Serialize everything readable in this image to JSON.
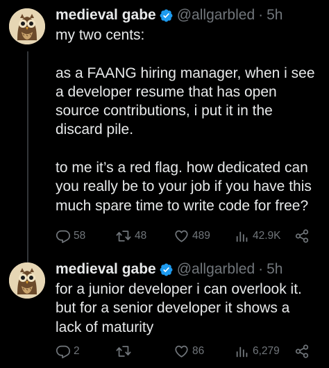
{
  "tweets": [
    {
      "author": {
        "display_name": "medieval gabe",
        "handle": "@allgarbled",
        "verified": true,
        "avatar_icon": "owl-avatar"
      },
      "separator": "·",
      "time": "5h",
      "text": "my two cents:\n\nas a FAANG hiring manager, when i see\na developer resume that has open\nsource contributions, i put it in the\ndiscard pile.\n\nto me it’s a red flag. how dedicated can\nyou really be to your job if you have this\nmuch spare time to write code for free?",
      "stats": {
        "replies": "58",
        "retweets": "48",
        "likes": "489",
        "views": "42.9K"
      }
    },
    {
      "author": {
        "display_name": "medieval gabe",
        "handle": "@allgarbled",
        "verified": true,
        "avatar_icon": "owl-avatar"
      },
      "separator": "·",
      "time": "5h",
      "text": "for a junior developer i can overlook it.\nbut for a senior developer it shows a\nlack of maturity",
      "stats": {
        "replies": "2",
        "retweets": "",
        "likes": "86",
        "views": "6,279"
      }
    }
  ],
  "icons": {
    "reply": "reply-icon",
    "retweet": "retweet-icon",
    "like": "heart-icon",
    "views": "views-icon",
    "share": "share-icon",
    "verified": "verified-badge-icon"
  },
  "colors": {
    "background": "#000000",
    "text_primary": "#e7e9ea",
    "text_secondary": "#71767b",
    "verified_blue": "#1d9bf0",
    "thread_line": "#333639"
  }
}
